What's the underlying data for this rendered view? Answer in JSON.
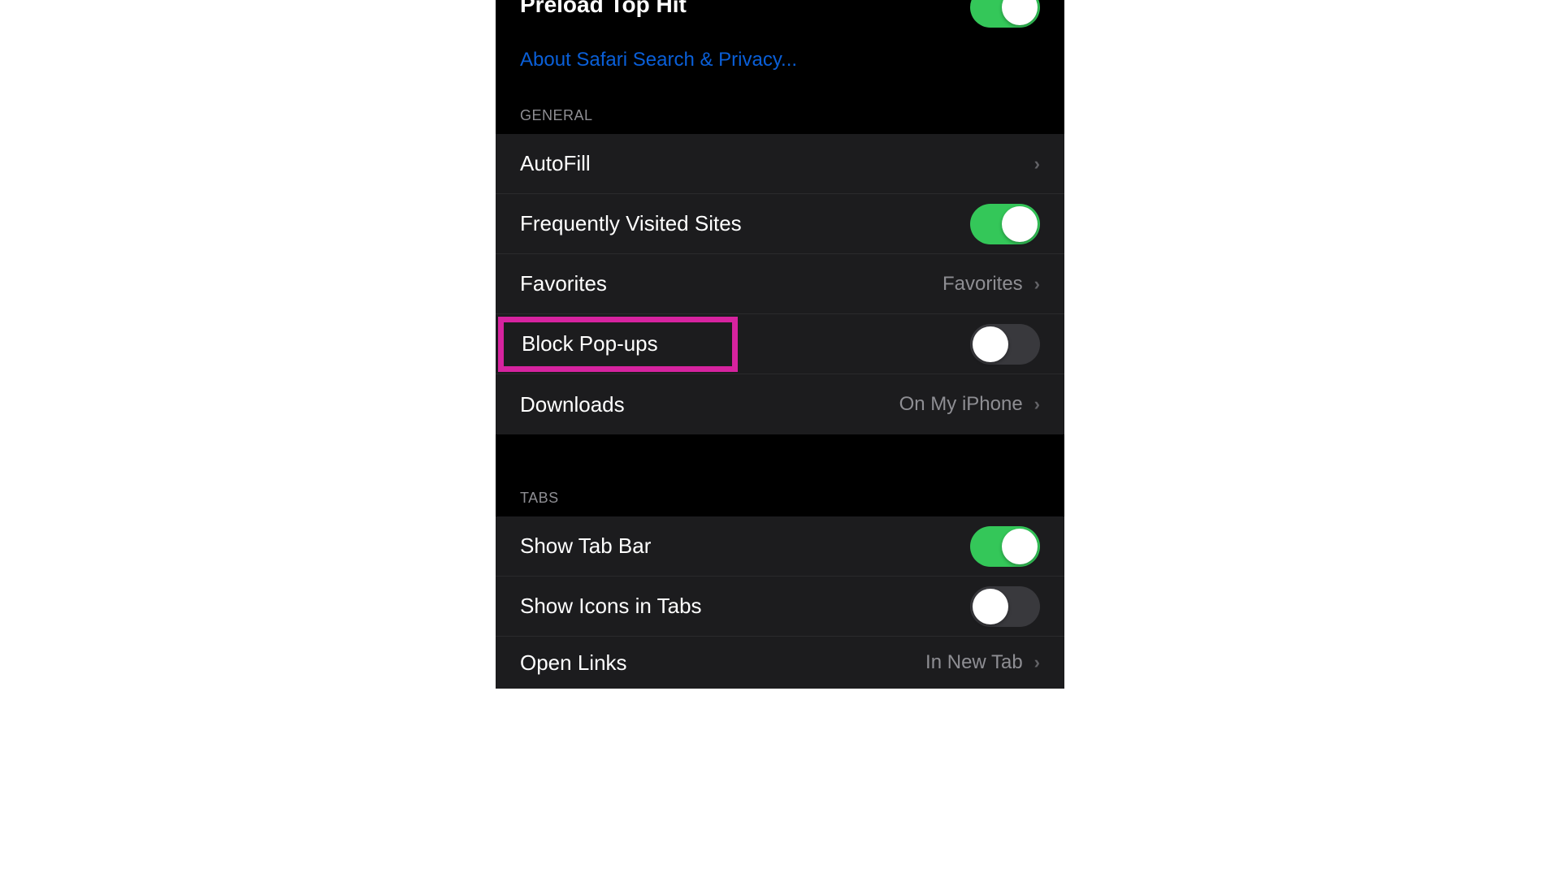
{
  "top": {
    "preload_label": "Preload Top Hit",
    "about_link": "About Safari Search & Privacy..."
  },
  "general": {
    "header": "GENERAL",
    "autofill_label": "AutoFill",
    "freq_label": "Frequently Visited Sites",
    "favorites_label": "Favorites",
    "favorites_value": "Favorites",
    "block_popups_label": "Block Pop-ups",
    "downloads_label": "Downloads",
    "downloads_value": "On My iPhone"
  },
  "tabs": {
    "header": "TABS",
    "show_tab_bar_label": "Show Tab Bar",
    "show_icons_label": "Show Icons in Tabs",
    "open_links_label": "Open Links",
    "open_links_value": "In New Tab"
  }
}
